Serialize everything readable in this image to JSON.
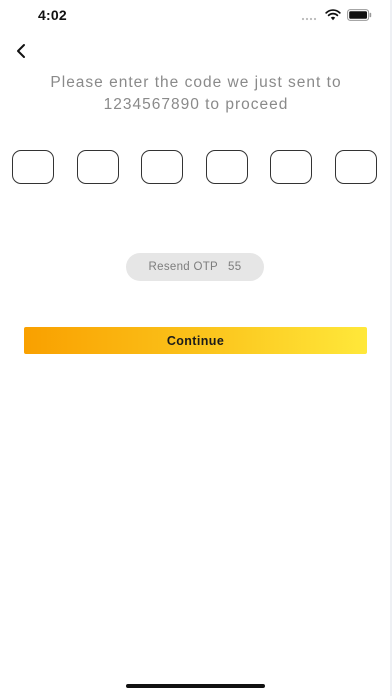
{
  "status_bar": {
    "time": "4:02",
    "icons": [
      "signal-icon",
      "wifi-icon",
      "battery-icon"
    ]
  },
  "back": {
    "icon": "chevron-left-icon"
  },
  "instruction": {
    "line1": "Please enter the code we just sent to",
    "line2": "1234567890 to proceed"
  },
  "otp": {
    "digits": [
      "",
      "",
      "",
      "",
      "",
      ""
    ]
  },
  "resend": {
    "label": "Resend OTP",
    "countdown": "55"
  },
  "continue_label": "Continue",
  "colors": {
    "accent_start": "#f9a000",
    "accent_end": "#ffe83a",
    "muted_text": "#8a8a8a",
    "pill_bg": "#e6e6e6"
  }
}
